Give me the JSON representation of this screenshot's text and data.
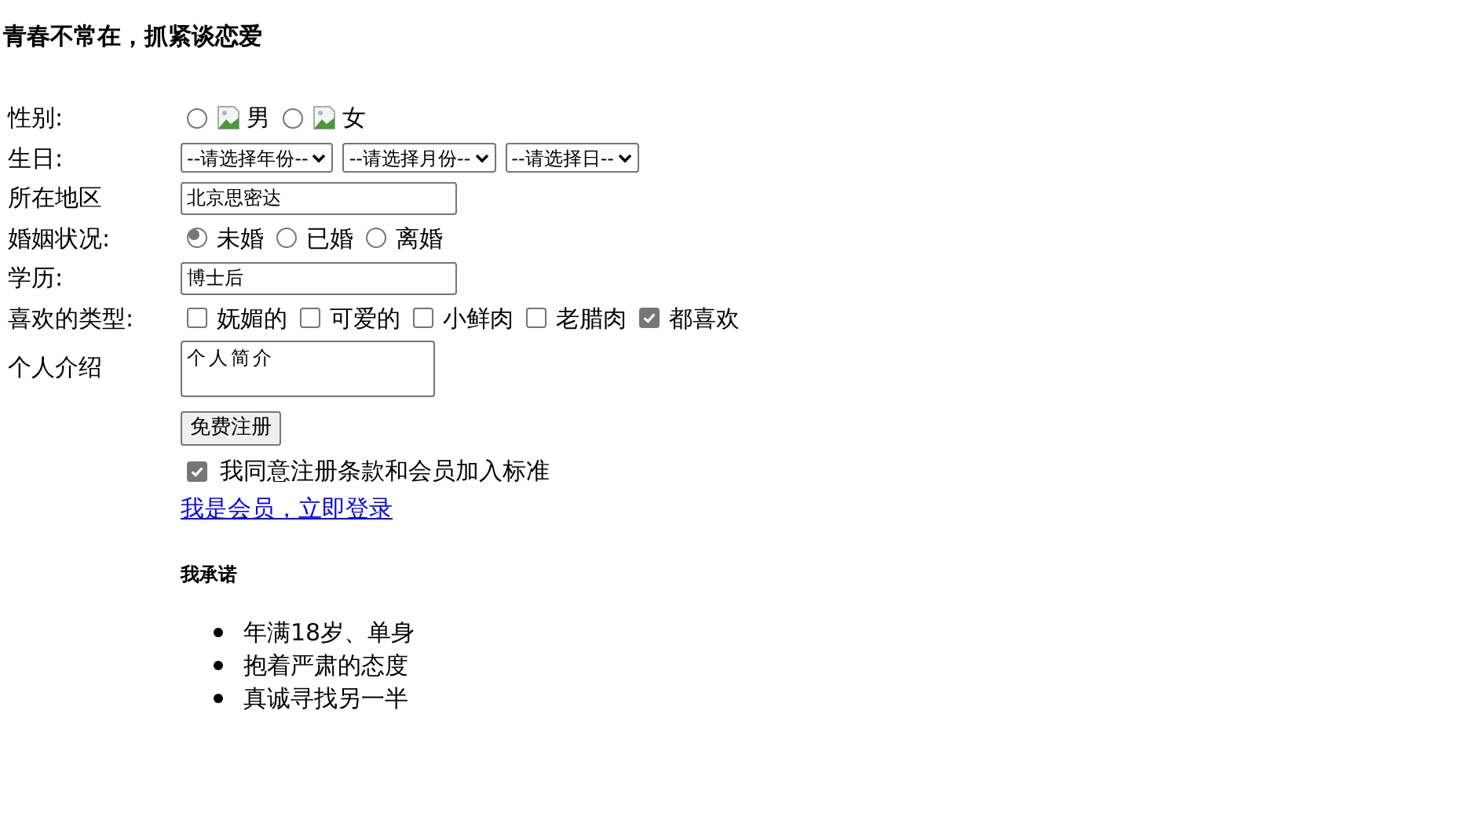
{
  "title": "青春不常在，抓紧谈恋爱",
  "rows": [
    {
      "kind": "radio_images",
      "label": "性别:",
      "options": [
        {
          "label": "男",
          "selected": false
        },
        {
          "label": "女",
          "selected": false
        }
      ]
    },
    {
      "kind": "selects",
      "label": "生日:",
      "selects": [
        "--请选择年份--",
        "--请选择月份--",
        "--请选择日--"
      ]
    },
    {
      "kind": "text",
      "label": "所在地区",
      "value": "北京思密达"
    },
    {
      "kind": "radio",
      "label": "婚姻状况:",
      "options": [
        {
          "label": "未婚",
          "selected": true
        },
        {
          "label": "已婚",
          "selected": false
        },
        {
          "label": "离婚",
          "selected": false
        }
      ]
    },
    {
      "kind": "text",
      "label": "学历:",
      "value": "博士后"
    },
    {
      "kind": "checks",
      "label": "喜欢的类型:",
      "options": [
        {
          "label": "妩媚的",
          "checked": false
        },
        {
          "label": "可爱的",
          "checked": false
        },
        {
          "label": "小鲜肉",
          "checked": false
        },
        {
          "label": "老腊肉",
          "checked": false
        },
        {
          "label": "都喜欢",
          "checked": true
        }
      ]
    },
    {
      "kind": "textarea",
      "label": "个人介绍",
      "value": "个人简介"
    }
  ],
  "submit": "免费注册",
  "agree": {
    "label": "我同意注册条款和会员加入标准",
    "checked": true
  },
  "login_link": "我是会员，立即登录",
  "pledge": {
    "title": "我承诺",
    "items": [
      "年满18岁、单身",
      "抱着严肃的态度",
      "真诚寻找另一半"
    ]
  }
}
